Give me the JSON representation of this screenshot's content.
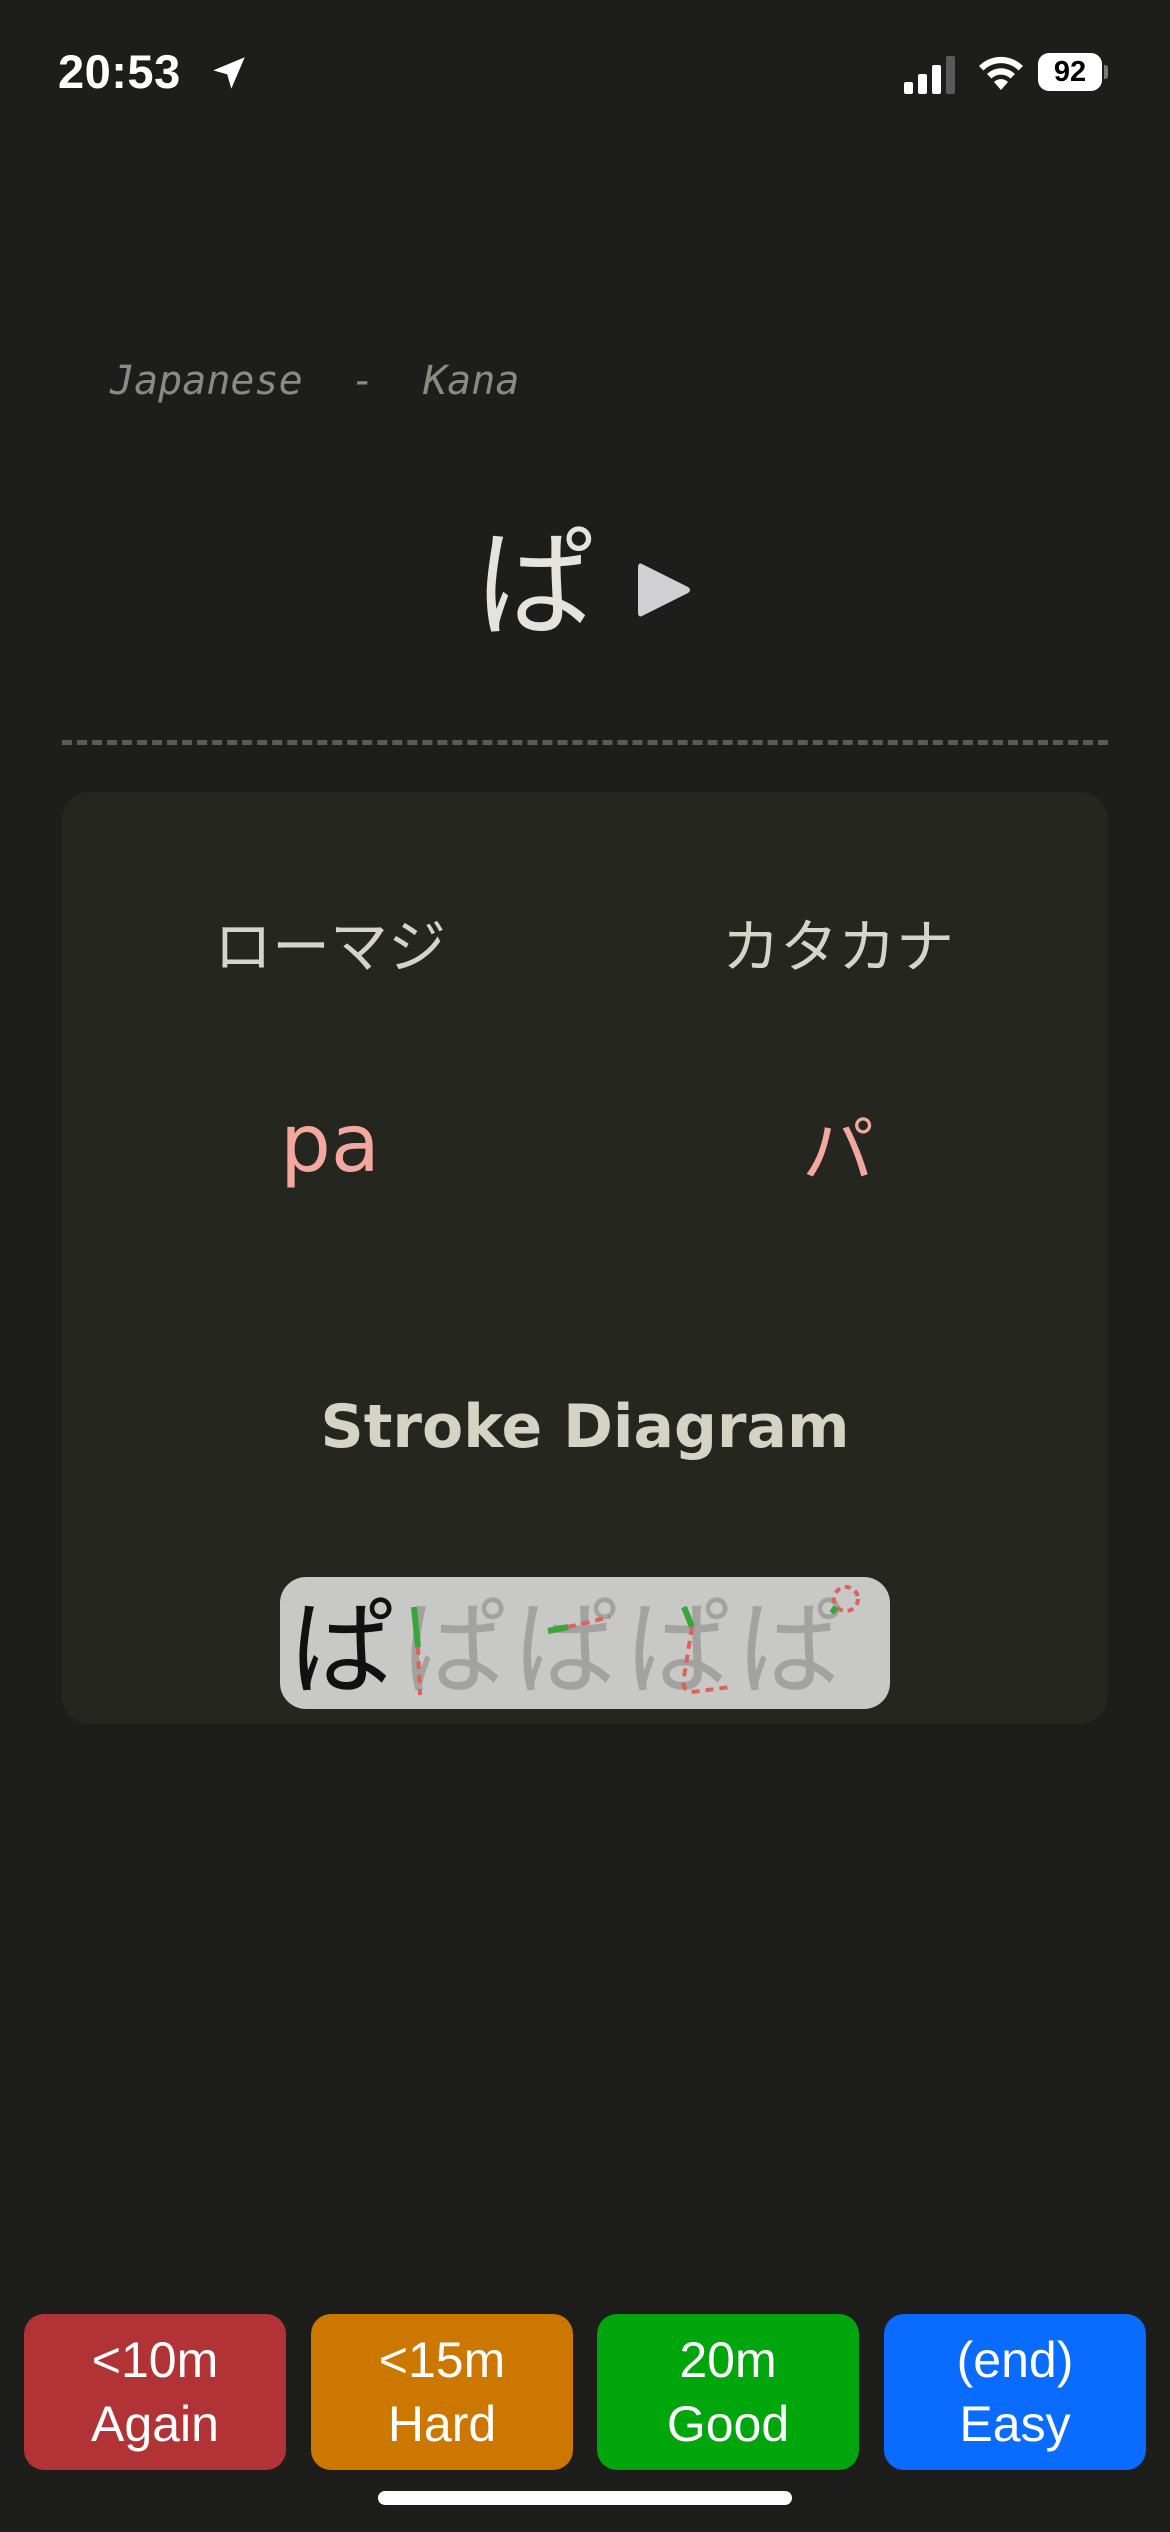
{
  "status_bar": {
    "time": "20:53",
    "battery_level": "92",
    "icons": [
      "location-arrow-icon",
      "cellular-signal-icon",
      "wifi-icon",
      "battery-icon"
    ]
  },
  "card": {
    "deck": "Japanese  -  Kana",
    "front": "ぱ",
    "play_icon": "play-icon"
  },
  "answer": {
    "romaji_header": "ローマジ",
    "katakana_header": "カタカナ",
    "romaji_value": "pa",
    "katakana_value": "パ",
    "stroke_title": "Stroke Diagram",
    "stroke_frames": [
      "ぱ",
      "ぱ",
      "ぱ",
      "ぱ",
      "ぱ"
    ]
  },
  "buttons": [
    {
      "interval": "<10m",
      "label": "Again",
      "color": "#b23335"
    },
    {
      "interval": "<15m",
      "label": "Hard",
      "color": "#cc7700"
    },
    {
      "interval": "20m",
      "label": "Good",
      "color": "#00a60c"
    },
    {
      "interval": "(end)",
      "label": "Easy",
      "color": "#0a6bff"
    }
  ],
  "colors": {
    "background": "#1d1d1b",
    "card_panel": "#252620",
    "answer_text": "#f2a89e",
    "stroke_active": "#111111",
    "stroke_ghost": "#a0a09e",
    "stroke_green": "#3aa53a",
    "stroke_red": "#e0605a"
  }
}
